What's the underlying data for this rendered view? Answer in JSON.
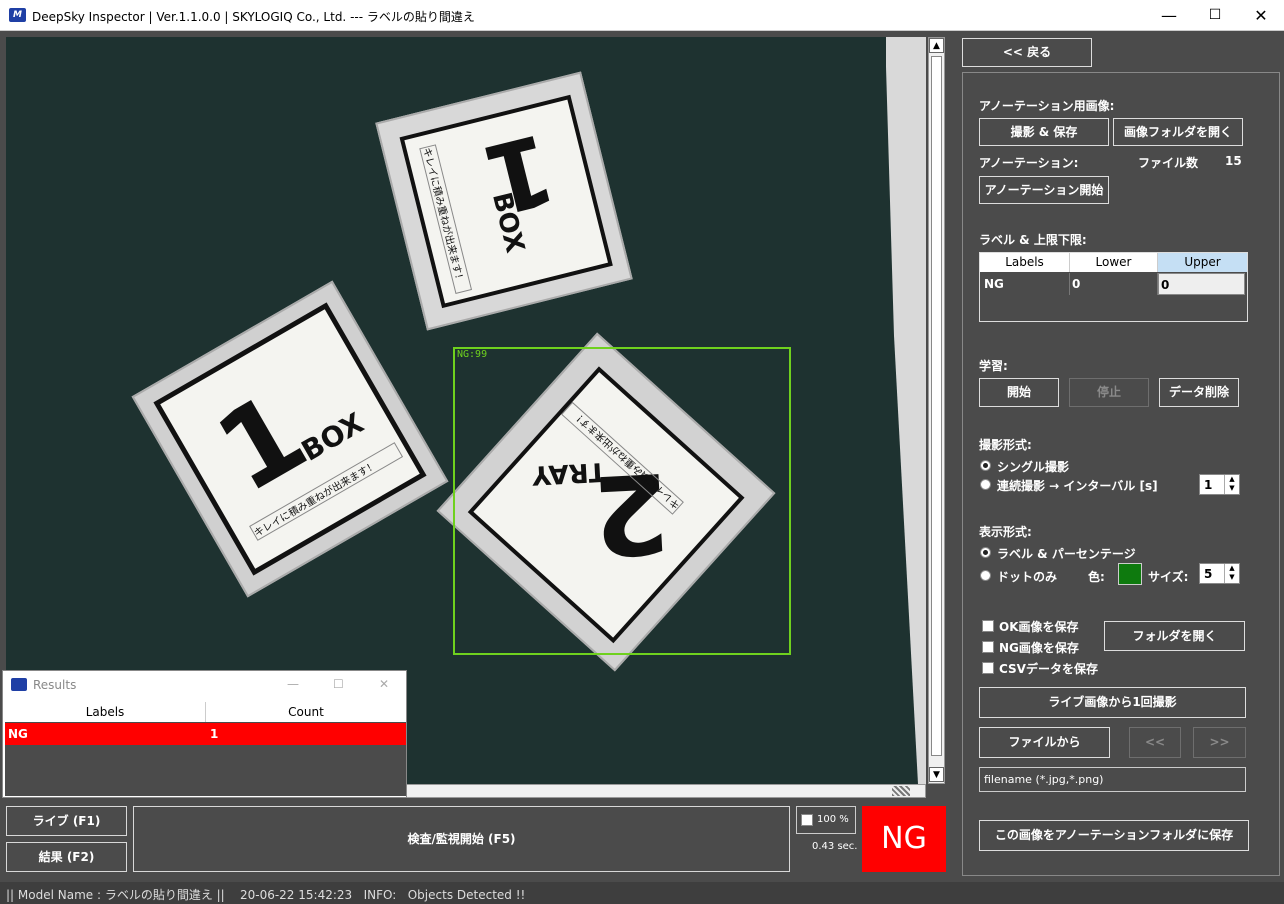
{
  "window": {
    "logo": "M",
    "title": "DeepSky Inspector | Ver.1.1.0.0 | SKYLOGIQ Co., Ltd. --- ラベルの貼り間違え",
    "minimize": "—",
    "maximize": "☐",
    "close": "✕"
  },
  "image": {
    "detection_label": "NG:99",
    "box1": {
      "number": "1",
      "word": "BOX",
      "caption": "キレイに積み重ねが出来ます！"
    },
    "box2": {
      "number": "1",
      "word": "BOX",
      "caption": "キレイに積み重ねが出来ます！"
    },
    "box3": {
      "number": "2",
      "word": "TRAY",
      "caption": "キレイに積み重ねが出来ます！"
    }
  },
  "scroll": {
    "up": "▲",
    "down": "▼"
  },
  "bottom": {
    "live_button": "ライブ (F1)",
    "result_button": "結果 (F2)",
    "inspect_button": "検査/監視開始 (F5)",
    "zoom_label": "100 %",
    "time": "0.43 sec.",
    "verdict": "NG",
    "verdict_color": "#ff0000"
  },
  "results": {
    "title": "Results",
    "minimize": "—",
    "maximize": "☐",
    "close": "✕",
    "columns": [
      "Labels",
      "Count"
    ],
    "rows": [
      {
        "label": "NG",
        "count": "1"
      }
    ],
    "row_color": "#ff0000"
  },
  "panel": {
    "back_button": "<< 戻る",
    "annotation_image_label": "アノーテーション用画像:",
    "capture_save_button": "撮影 & 保存",
    "open_image_folder_button": "画像フォルダを開く",
    "annotation_label": "アノーテーション:",
    "file_count_label": "ファイル数",
    "file_count": "15",
    "annotation_start_button": "アノーテーション開始",
    "label_limits_label": "ラベル & 上限下限:",
    "grid": {
      "columns": [
        "Labels",
        "Lower",
        "Upper"
      ],
      "row": [
        "NG",
        "0",
        "0"
      ],
      "header_highlight": "#c5dff4"
    },
    "learning_label": "学習:",
    "start_button": "開始",
    "stop_button": "停止",
    "delete_data_button": "データ削除",
    "capture_mode_label": "撮影形式:",
    "single_capture": "シングル撮影",
    "continuous_capture": "連続撮影 → インターバル [s]",
    "interval_value": "1",
    "display_mode_label": "表示形式:",
    "label_percentage": "ラベル & パーセンテージ",
    "dot_only": "ドットのみ",
    "color_label": "色:",
    "dot_color": "#0e7a0e",
    "size_label": "サイズ:",
    "size_value": "5",
    "save_ok": "OK画像を保存",
    "save_ng": "NG画像を保存",
    "save_csv": "CSVデータを保存",
    "open_folder_button": "フォルダを開く",
    "capture_once_button": "ライブ画像から1回撮影",
    "from_file_button": "ファイルから",
    "prev_button": "<<",
    "next_button": ">>",
    "filename_placeholder": "filename (*.jpg,*.png)",
    "save_to_annotation_button": "この画像をアノーテーションフォルダに保存"
  },
  "status": {
    "text": "|| Model Name : ラベルの貼り間違え ||    20-06-22 15:42:23   INFO:   Objects Detected !!"
  }
}
